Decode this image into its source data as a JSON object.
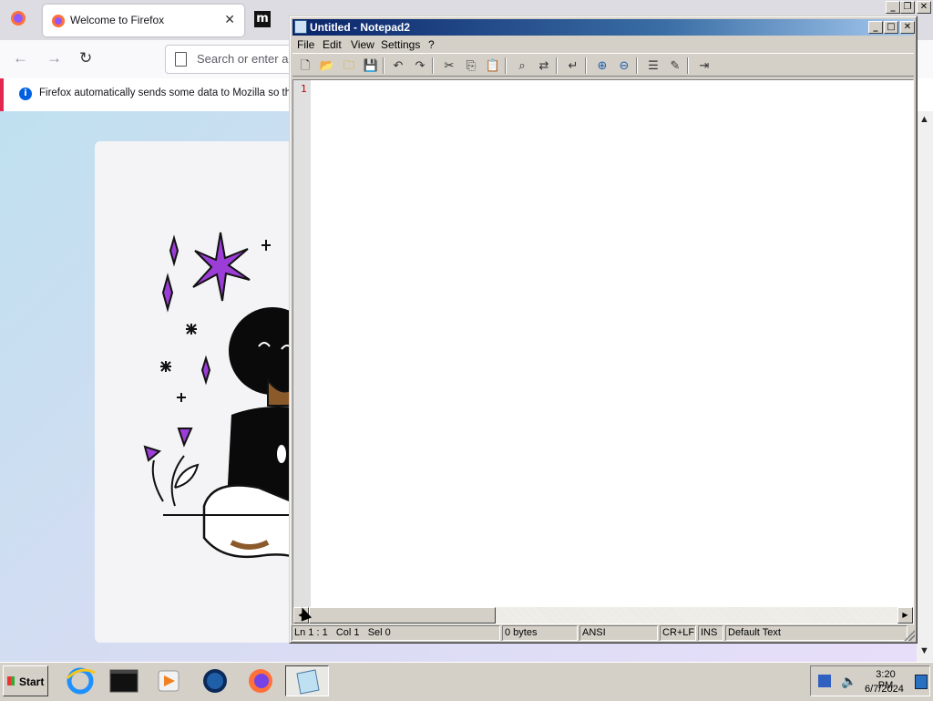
{
  "firefox": {
    "tab_title": "Welcome to Firefox",
    "tab_close": "✕",
    "second_tab_icon": "m",
    "address_placeholder": "Search or enter a",
    "notice_text": "Firefox automatically sends some data to Mozilla so that",
    "info_glyph": "i",
    "scroll_up": "▲",
    "scroll_down": "▼"
  },
  "os_caption": {
    "minimize": "_",
    "restore": "❐",
    "close": "✕"
  },
  "notepad": {
    "title": "Untitled - Notepad2",
    "menu": [
      "File",
      "Edit",
      "View",
      "Settings",
      "?"
    ],
    "line_number": "1",
    "status": {
      "position": "Ln 1 : 1   Col 1   Sel 0",
      "size": "0 bytes",
      "encoding": "ANSI",
      "eol": "CR+LF",
      "mode": "INS",
      "scheme": "Default Text"
    }
  },
  "taskbar": {
    "start_label": "Start",
    "time": "3:20 PM",
    "date": "6/7/2024"
  }
}
